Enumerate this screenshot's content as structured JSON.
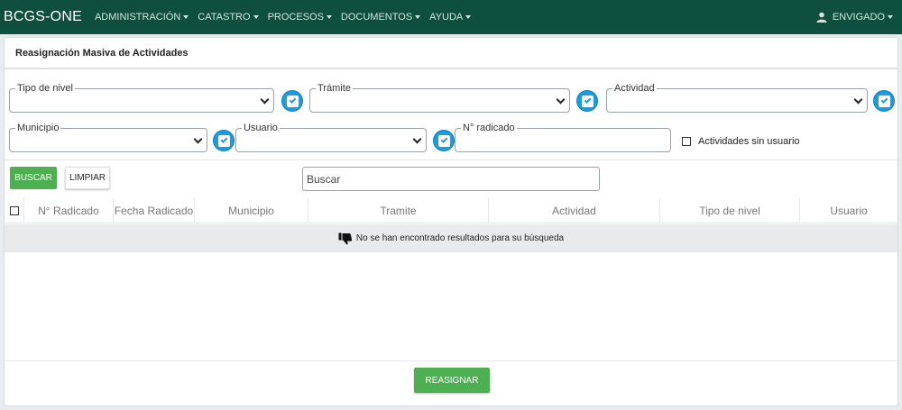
{
  "nav": {
    "brand": "BCGS-ONE",
    "menus": [
      "ADMINISTRACIÓN",
      "CATASTRO",
      "PROCESOS",
      "DOCUMENTOS",
      "AYUDA"
    ],
    "user": "ENVIGADO"
  },
  "page": {
    "title": "Reasignación Masiva de Actividades"
  },
  "filters": {
    "tipo_nivel": {
      "label": "Tipo de nivel",
      "value": ""
    },
    "tramite": {
      "label": "Trámite",
      "value": ""
    },
    "actividad": {
      "label": "Actividad",
      "value": ""
    },
    "municipio": {
      "label": "Municipio",
      "value": ""
    },
    "usuario": {
      "label": "Usuario",
      "value": ""
    },
    "radicado": {
      "label": "N° radicado",
      "value": ""
    },
    "sin_usuario": {
      "label": "Actividades sin usuario",
      "checked": false
    }
  },
  "actions": {
    "buscar": "BUSCAR",
    "limpiar": "LIMPIAR",
    "search_placeholder": "Buscar",
    "reasignar": "REASIGNAR"
  },
  "table": {
    "columns": [
      "N° Radicado",
      "Fecha Radicado",
      "Municipio",
      "Tramite",
      "Actividad",
      "Tipo de nivel",
      "Usuario"
    ],
    "rows": [],
    "empty_message": "No se han encontrado resultados para su búsqueda"
  },
  "colors": {
    "navbar": "#0f4f3f",
    "primary_button": "#4caf50",
    "check_badge": "#1a9de0"
  }
}
